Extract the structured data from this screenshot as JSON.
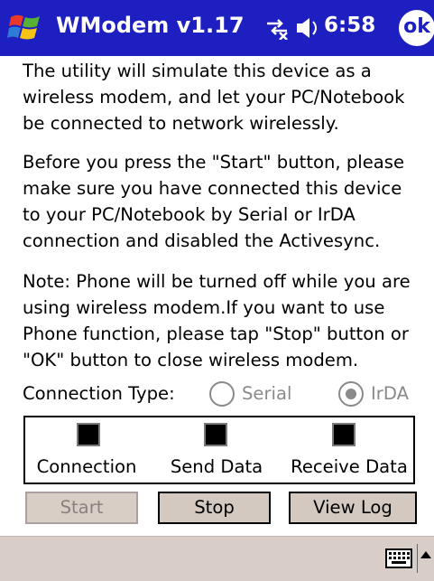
{
  "titlebar": {
    "start_icon": "windows-flag-icon",
    "title": "WModem v1.17",
    "connectivity_icon": "connectivity-icon",
    "volume_icon": "speaker-icon",
    "time": "6:58",
    "ok_label": "ok"
  },
  "content": {
    "paragraph1": "The utility will simulate this device as a wireless modem, and let your PC/Notebook be connected to network wirelessly.",
    "paragraph2": "Before you press the \"Start\" button, please make sure you have connected this device to your PC/Notebook by Serial or IrDA connection and disabled the Activesync.",
    "paragraph3": "Note: Phone will be turned off while you are using wireless modem.If you want to use Phone function, please tap \"Stop\" button or \"OK\" button to close wireless modem."
  },
  "connection": {
    "label": "Connection Type:",
    "options": [
      {
        "label": "Serial",
        "selected": false
      },
      {
        "label": "IrDA",
        "selected": true
      }
    ]
  },
  "status": {
    "indicators": [
      {
        "label": "Connection",
        "on": false
      },
      {
        "label": "Send Data",
        "on": false
      },
      {
        "label": "Receive Data",
        "on": false
      }
    ]
  },
  "buttons": {
    "start": "Start",
    "stop": "Stop",
    "view_log": "View Log"
  },
  "bottombar": {
    "keyboard_icon": "keyboard-icon",
    "sip_arrow_icon": "up-arrow-icon"
  },
  "colors": {
    "titlebar": "#1e1fc0",
    "button_face": "#d4c9c0",
    "disabled_text": "#8a8a8a"
  }
}
